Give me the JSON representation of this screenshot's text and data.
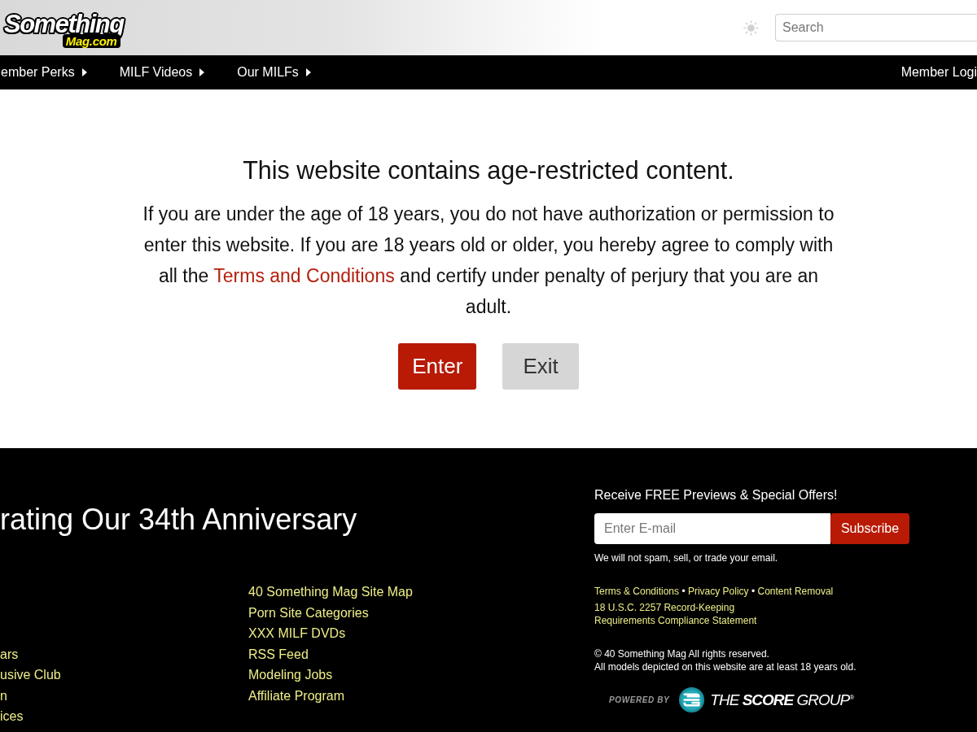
{
  "header": {
    "logo": {
      "word": "Something",
      "domain": "Mag.com"
    },
    "search": {
      "placeholder": "Search"
    }
  },
  "nav": {
    "items": [
      {
        "label": "ember Perks",
        "has_submenu": true
      },
      {
        "label": "MILF Videos",
        "has_submenu": true
      },
      {
        "label": "Our MILFs",
        "has_submenu": true
      }
    ],
    "login": "Member Logi"
  },
  "age_gate": {
    "title": "This website contains age-restricted content.",
    "text_before": "If you are under the age of 18 years, you do not have authorization or permission to enter this website. If you are 18 years old or older, you hereby agree to comply with all the ",
    "link": "Terms and Conditions",
    "text_after": " and certify under penalty of perjury that you are an adult.",
    "buttons": [
      {
        "label": "Enter",
        "kind": "primary"
      },
      {
        "label": "Exit",
        "kind": "secondary"
      }
    ]
  },
  "footer": {
    "title": "rating Our 34th Anniversary",
    "link_columns": [
      {
        "links": [
          "ars",
          "usive Club",
          "n",
          "ices"
        ]
      },
      {
        "links": [
          "40 Something Mag Site Map",
          "Porn Site Categories",
          "XXX MILF DVDs",
          "RSS Feed",
          "Modeling Jobs",
          "Affiliate Program"
        ]
      }
    ],
    "newsletter": {
      "heading": "Receive FREE Previews & Special Offers!",
      "placeholder": "Enter E-mail",
      "button": "Subscribe",
      "note": "We will not spam, sell, or trade your email."
    },
    "legal_links": [
      "Terms & Conditions",
      "Privacy Policy",
      "Content Removal"
    ],
    "separator": "•",
    "compliance_link": "18 U.S.C. 2257 Record-Keeping Requirements Compliance Statement",
    "copyright": [
      "© 40 Something Mag All rights reserved.",
      "All models depicted on this website are at least 18 years old."
    ],
    "powered_by": {
      "label": "POWERED BY",
      "brand": "THE **SCORE** GROUP$^{®}$"
    }
  }
}
